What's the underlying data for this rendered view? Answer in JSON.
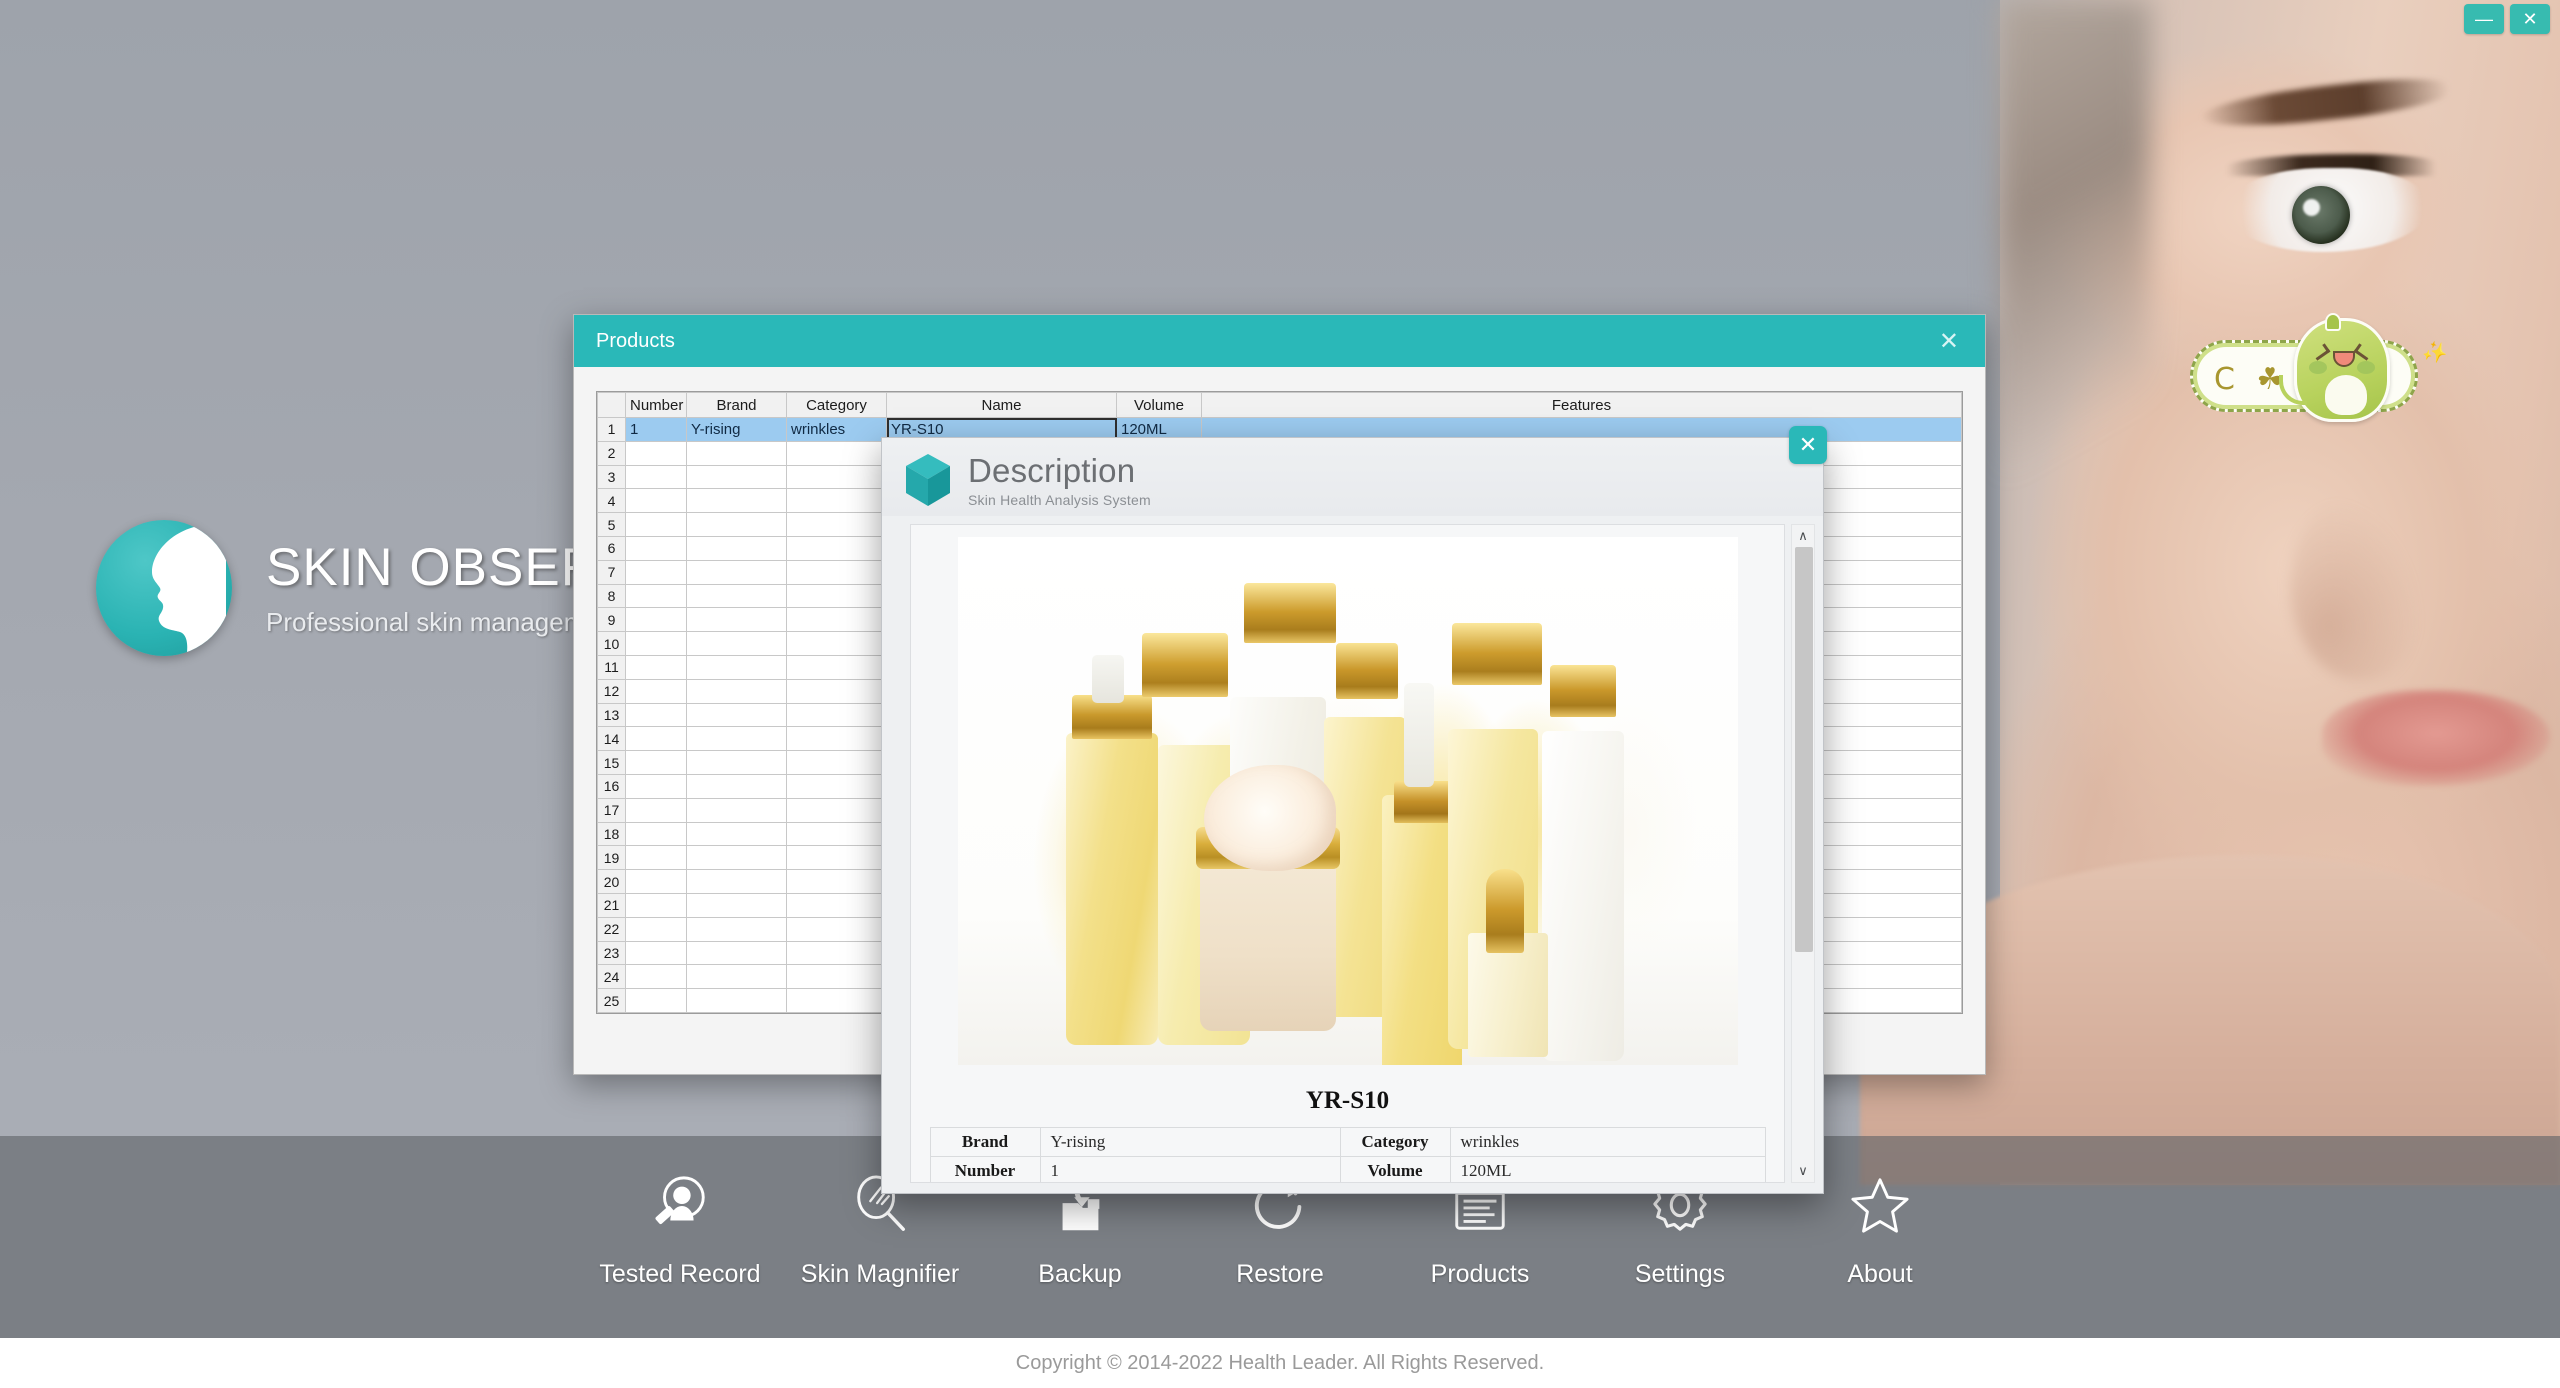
{
  "window_controls": {
    "minimize_label": "—",
    "close_label": "✕"
  },
  "branding": {
    "logo_icon": "face-profile-logo-icon",
    "title": "SKIN OBSERVED",
    "subtitle": "Professional skin management system"
  },
  "mascot": {
    "name": "green-dinosaur-sticker",
    "glyphs": "C ☘",
    "spark": "✨"
  },
  "products_window": {
    "title": "Products",
    "close_label": "✕",
    "grid": {
      "columns": [
        "",
        "Number",
        "Brand",
        "Category",
        "Name",
        "Volume",
        "Features"
      ],
      "rows": [
        {
          "n": "1",
          "number": "1",
          "brand": "Y-rising",
          "category": "wrinkles",
          "name": "YR-S10",
          "volume": "120ML",
          "features": "",
          "selected": true,
          "editing_cell": "name"
        },
        {
          "n": "2",
          "number": "",
          "brand": "",
          "category": "",
          "name": "",
          "volume": "",
          "features": ""
        },
        {
          "n": "3",
          "number": "",
          "brand": "",
          "category": "",
          "name": "",
          "volume": "",
          "features": ""
        },
        {
          "n": "4",
          "number": "",
          "brand": "",
          "category": "",
          "name": "",
          "volume": "",
          "features": ""
        },
        {
          "n": "5",
          "number": "",
          "brand": "",
          "category": "",
          "name": "",
          "volume": "",
          "features": ""
        },
        {
          "n": "6",
          "number": "",
          "brand": "",
          "category": "",
          "name": "",
          "volume": "",
          "features": ""
        },
        {
          "n": "7",
          "number": "",
          "brand": "",
          "category": "",
          "name": "",
          "volume": "",
          "features": ""
        },
        {
          "n": "8",
          "number": "",
          "brand": "",
          "category": "",
          "name": "",
          "volume": "",
          "features": ""
        },
        {
          "n": "9",
          "number": "",
          "brand": "",
          "category": "",
          "name": "",
          "volume": "",
          "features": ""
        },
        {
          "n": "10",
          "number": "",
          "brand": "",
          "category": "",
          "name": "",
          "volume": "",
          "features": ""
        },
        {
          "n": "11",
          "number": "",
          "brand": "",
          "category": "",
          "name": "",
          "volume": "",
          "features": ""
        },
        {
          "n": "12",
          "number": "",
          "brand": "",
          "category": "",
          "name": "",
          "volume": "",
          "features": ""
        },
        {
          "n": "13",
          "number": "",
          "brand": "",
          "category": "",
          "name": "",
          "volume": "",
          "features": ""
        },
        {
          "n": "14",
          "number": "",
          "brand": "",
          "category": "",
          "name": "",
          "volume": "",
          "features": ""
        },
        {
          "n": "15",
          "number": "",
          "brand": "",
          "category": "",
          "name": "",
          "volume": "",
          "features": ""
        },
        {
          "n": "16",
          "number": "",
          "brand": "",
          "category": "",
          "name": "",
          "volume": "",
          "features": ""
        },
        {
          "n": "17",
          "number": "",
          "brand": "",
          "category": "",
          "name": "",
          "volume": "",
          "features": ""
        },
        {
          "n": "18",
          "number": "",
          "brand": "",
          "category": "",
          "name": "",
          "volume": "",
          "features": ""
        },
        {
          "n": "19",
          "number": "",
          "brand": "",
          "category": "",
          "name": "",
          "volume": "",
          "features": ""
        },
        {
          "n": "20",
          "number": "",
          "brand": "",
          "category": "",
          "name": "",
          "volume": "",
          "features": ""
        },
        {
          "n": "21",
          "number": "",
          "brand": "",
          "category": "",
          "name": "",
          "volume": "",
          "features": ""
        },
        {
          "n": "22",
          "number": "",
          "brand": "",
          "category": "",
          "name": "",
          "volume": "",
          "features": ""
        },
        {
          "n": "23",
          "number": "",
          "brand": "",
          "category": "",
          "name": "",
          "volume": "",
          "features": ""
        },
        {
          "n": "24",
          "number": "",
          "brand": "",
          "category": "",
          "name": "",
          "volume": "",
          "features": ""
        },
        {
          "n": "25",
          "number": "",
          "brand": "",
          "category": "",
          "name": "",
          "volume": "",
          "features": ""
        }
      ]
    },
    "separator_marks": "===",
    "action_button_label": ""
  },
  "description_window": {
    "logo_icon": "cube-logo-icon",
    "heading": "Description",
    "subheading": "Skin Health Analysis System",
    "close_label": "✕",
    "product_image_alt": "cosmetic-bottles-photo",
    "product_title": "YR-S10",
    "details": [
      {
        "label_left": "Brand",
        "value_left": "Y-rising",
        "label_right": "Category",
        "value_right": "wrinkles"
      },
      {
        "label_left": "Number",
        "value_left": "1",
        "label_right": "Volume",
        "value_right": "120ML"
      }
    ],
    "scrollbar": {
      "up_label": "∧",
      "down_label": "∨"
    }
  },
  "toolbar": {
    "items": [
      {
        "label": "Tested Record",
        "icon": "tested-record-icon"
      },
      {
        "label": "Skin Magnifier",
        "icon": "skin-magnifier-icon"
      },
      {
        "label": "Backup",
        "icon": "backup-icon"
      },
      {
        "label": "Restore",
        "icon": "restore-icon"
      },
      {
        "label": "Products",
        "icon": "products-icon"
      },
      {
        "label": "Settings",
        "icon": "gear-icon"
      },
      {
        "label": "About",
        "icon": "star-icon"
      }
    ]
  },
  "footer": {
    "copyright": "Copyright © 2014-2022  Health Leader.  All Rights Reserved."
  },
  "colors": {
    "accent_teal": "#2ab8b8",
    "selection_blue": "#9ccbf0",
    "toolbar_band": "#606368",
    "desktop_gray": "#a4a8b0"
  }
}
